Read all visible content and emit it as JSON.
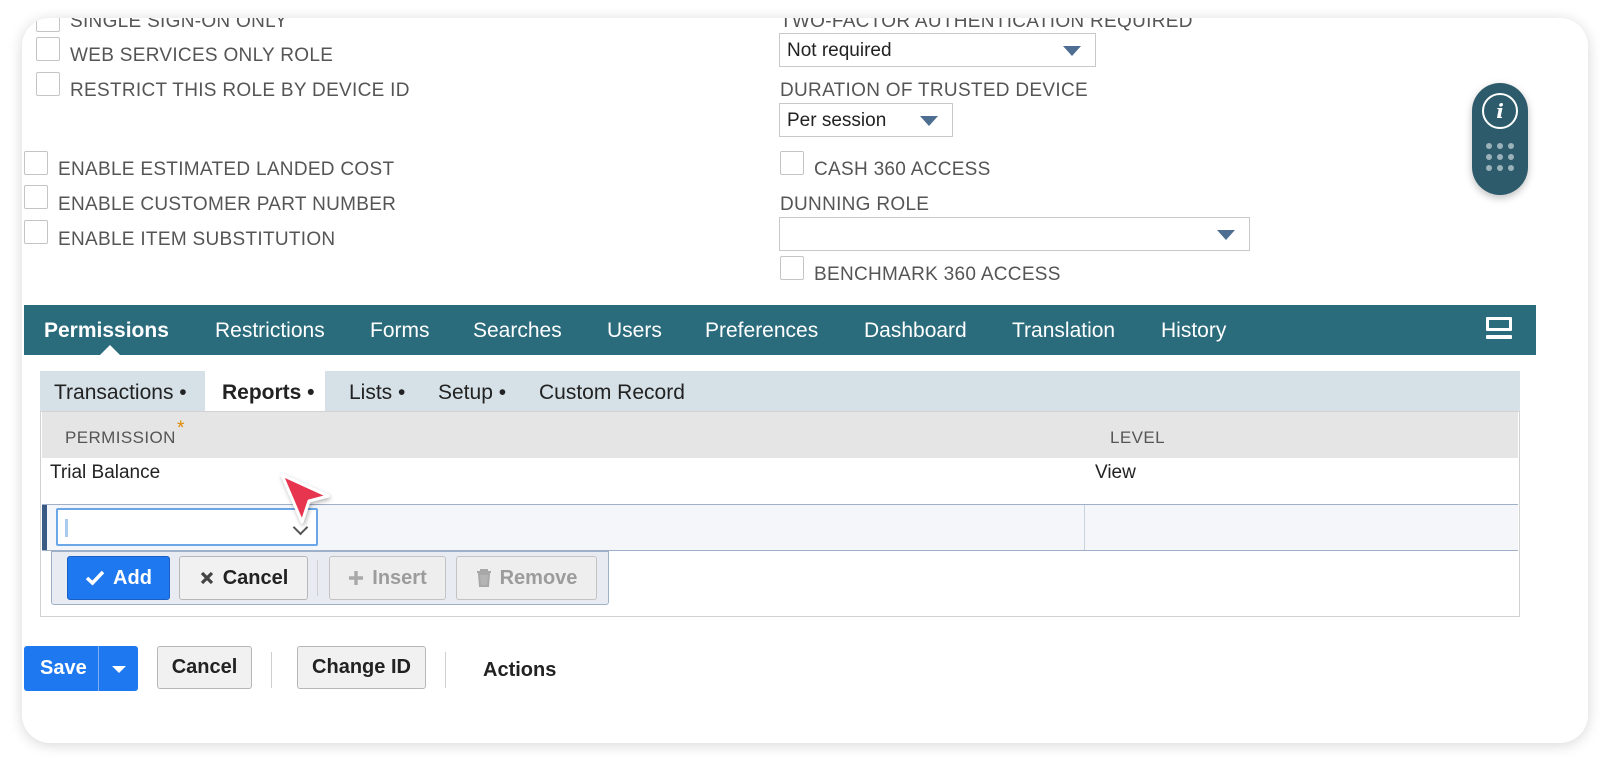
{
  "checkboxes_left_top": [
    {
      "label": "SINGLE SIGN-ON ONLY"
    },
    {
      "label": "WEB SERVICES ONLY ROLE"
    },
    {
      "label": "RESTRICT THIS ROLE BY DEVICE ID"
    }
  ],
  "checkboxes_left_bottom": [
    {
      "label": "ENABLE ESTIMATED LANDED COST"
    },
    {
      "label": "ENABLE CUSTOMER PART NUMBER"
    },
    {
      "label": "ENABLE ITEM SUBSTITUTION"
    }
  ],
  "right_fields": {
    "two_factor_label": "TWO-FACTOR AUTHENTICATION REQUIRED",
    "two_factor_value": "Not required",
    "trusted_device_label": "DURATION OF TRUSTED DEVICE",
    "trusted_device_value": "Per session",
    "cash360_label": "CASH 360 ACCESS",
    "dunning_label": "DUNNING ROLE",
    "dunning_value": "",
    "benchmark360_label": "BENCHMARK 360 ACCESS"
  },
  "tabs": [
    {
      "label": "Permissions",
      "active": true
    },
    {
      "label": "Restrictions"
    },
    {
      "label": "Forms"
    },
    {
      "label": "Searches"
    },
    {
      "label": "Users"
    },
    {
      "label": "Preferences"
    },
    {
      "label": "Dashboard"
    },
    {
      "label": "Translation"
    },
    {
      "label": "History"
    }
  ],
  "subtabs": [
    {
      "label": "Transactions •"
    },
    {
      "label": "Reports •",
      "active": true
    },
    {
      "label": "Lists •"
    },
    {
      "label": "Setup •"
    },
    {
      "label": "Custom Record"
    }
  ],
  "table": {
    "col_permission": "PERMISSION",
    "required_mark": "*",
    "col_level": "LEVEL",
    "rows": [
      {
        "permission": "Trial Balance",
        "level": "View"
      }
    ]
  },
  "line_buttons": {
    "add": "Add",
    "cancel": "Cancel",
    "insert": "Insert",
    "remove": "Remove"
  },
  "footer": {
    "save": "Save",
    "cancel": "Cancel",
    "change_id": "Change ID",
    "actions": "Actions"
  },
  "colors": {
    "tab_bar": "#2a6b7c",
    "primary_blue": "#1e78f0",
    "subtab_bar": "#d5e1e7"
  }
}
